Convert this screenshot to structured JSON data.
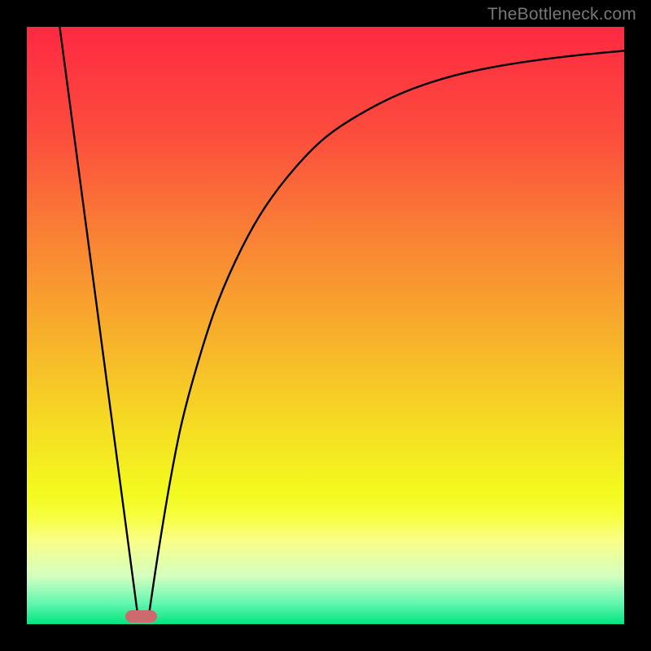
{
  "watermark": "TheBottleneck.com",
  "chart_data": {
    "type": "line",
    "title": "",
    "xlabel": "",
    "ylabel": "",
    "xlim": [
      0,
      100
    ],
    "ylim": [
      0,
      100
    ],
    "series": [
      {
        "name": "left-line",
        "x": [
          5.5,
          18.5
        ],
        "values": [
          100,
          2
        ]
      },
      {
        "name": "right-curve",
        "x": [
          20.5,
          22,
          24,
          26,
          29,
          32,
          36,
          40,
          45,
          50,
          56,
          63,
          71,
          80,
          90,
          100
        ],
        "values": [
          2,
          12,
          24,
          34,
          45,
          54,
          63,
          70,
          76.5,
          81.5,
          85.5,
          89,
          91.7,
          93.6,
          95,
          96
        ]
      }
    ],
    "marker": {
      "x": 19.2,
      "y": 1.3,
      "w": 5.3,
      "h": 2.0,
      "color": "#cd6a6e"
    },
    "gradient_stops": [
      {
        "offset": 0.0,
        "color": "#fe2942"
      },
      {
        "offset": 0.18,
        "color": "#fc4d3d"
      },
      {
        "offset": 0.36,
        "color": "#f98434"
      },
      {
        "offset": 0.52,
        "color": "#f7b12b"
      },
      {
        "offset": 0.66,
        "color": "#f5da24"
      },
      {
        "offset": 0.78,
        "color": "#f3fa1e"
      },
      {
        "offset": 0.82,
        "color": "#f6ff3f"
      },
      {
        "offset": 0.86,
        "color": "#faff88"
      },
      {
        "offset": 0.92,
        "color": "#d3ffbf"
      },
      {
        "offset": 0.965,
        "color": "#62f7b0"
      },
      {
        "offset": 1.0,
        "color": "#05e47e"
      }
    ]
  }
}
